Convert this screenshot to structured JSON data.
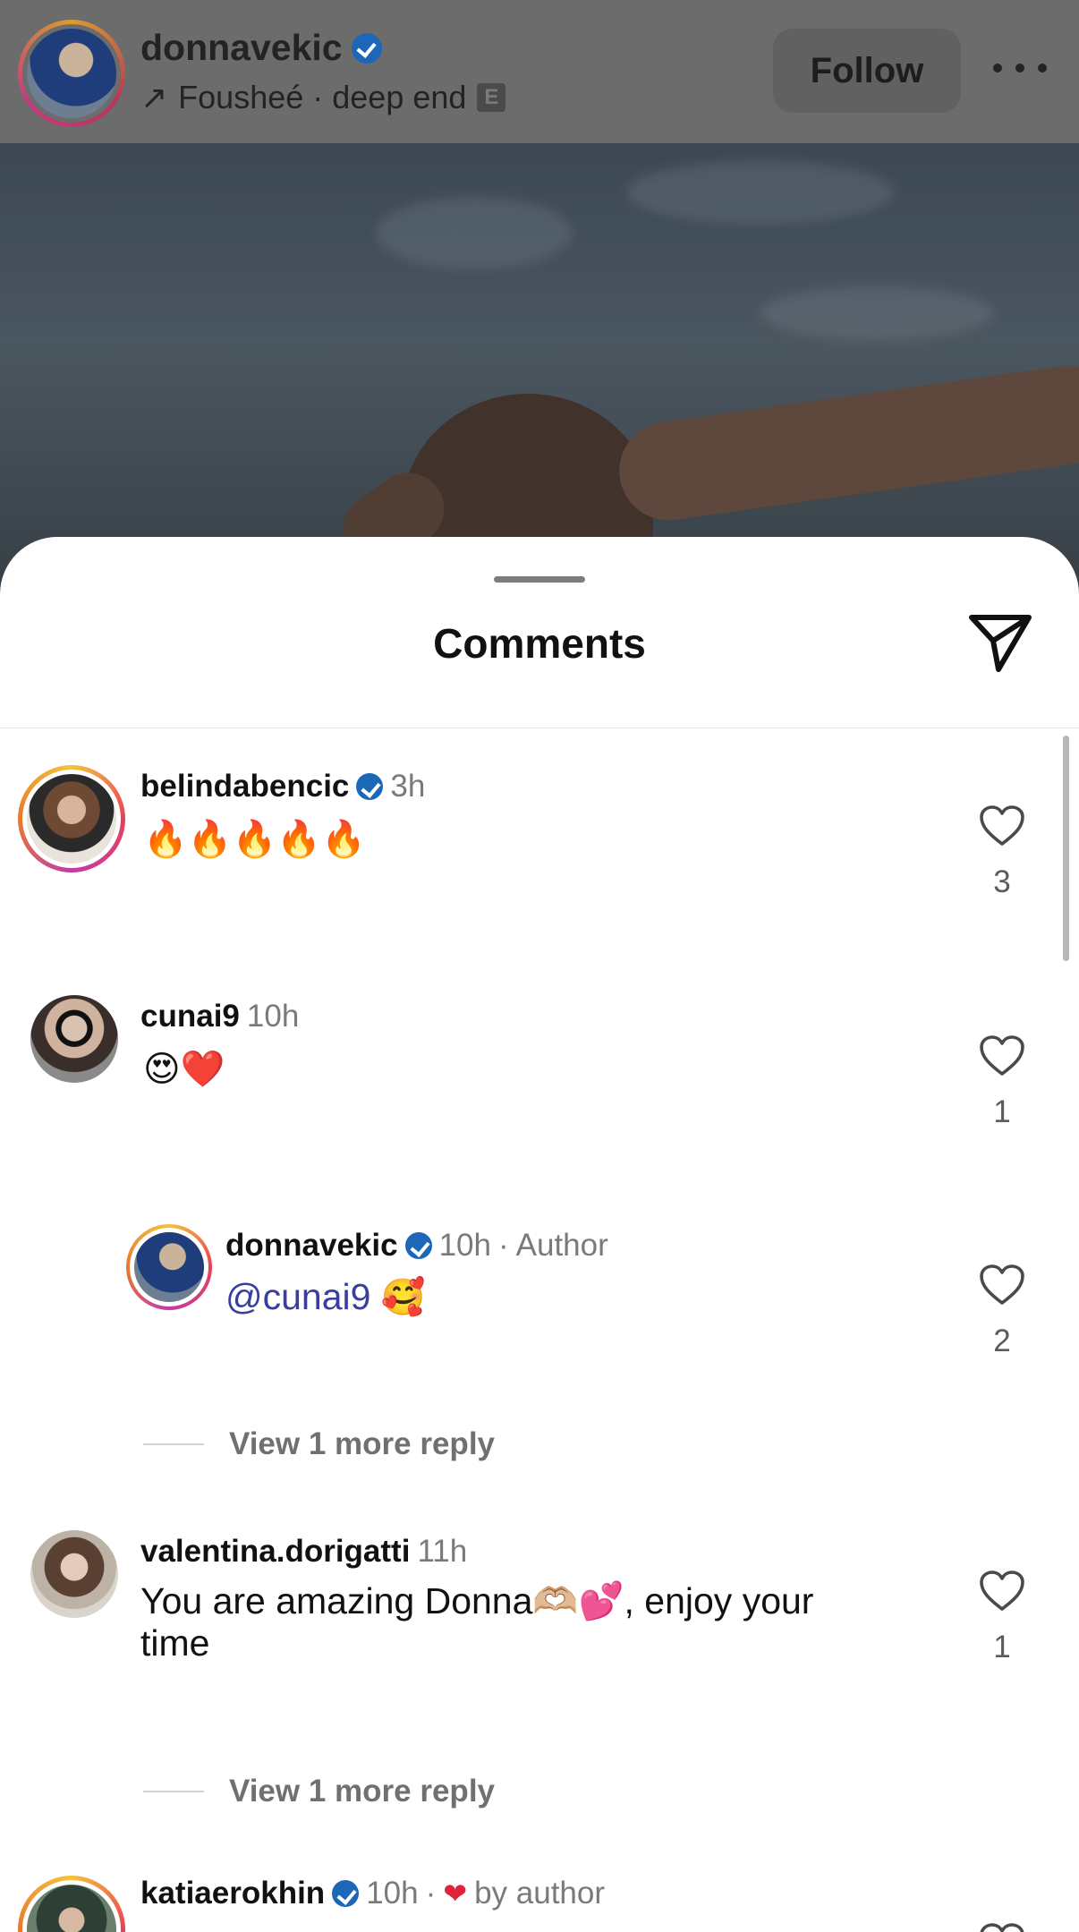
{
  "header": {
    "username": "donnavekic",
    "verified": true,
    "music_arrow": "↗",
    "music": "Fousheé · deep end",
    "explicit_badge": "E",
    "follow_label": "Follow",
    "more_icon": "more-horizontal-icon"
  },
  "sheet": {
    "title": "Comments",
    "share_icon": "paper-plane-icon"
  },
  "comments": [
    {
      "username": "belindabencic",
      "verified": true,
      "time": "3h",
      "text": "🔥🔥🔥🔥🔥",
      "likes": "3"
    },
    {
      "username": "cunai9",
      "verified": false,
      "time": "10h",
      "text": "😍❤️",
      "likes": "1"
    },
    {
      "username": "donnavekic",
      "verified": true,
      "time": "10h",
      "dot": "·",
      "author_label": "Author",
      "mention": "@cunai9",
      "text": "🥰",
      "likes": "2",
      "is_reply": true
    },
    {
      "username": "valentina.dorigatti",
      "verified": false,
      "time": "11h",
      "text_line1": "You are amazing Donna🫶🏼💕, enjoy your",
      "text_line2": "time",
      "likes": "1"
    },
    {
      "username": "katiaerokhin",
      "verified": true,
      "time": "10h",
      "dot": "·",
      "liked_by": "by author"
    }
  ],
  "view_more_1": "View 1 more reply",
  "view_more_2": "View 1 more reply",
  "colors": {
    "verified_blue": "#1d67b8",
    "mention_blue": "#3a3f9e",
    "heart_red": "#e0223a"
  }
}
